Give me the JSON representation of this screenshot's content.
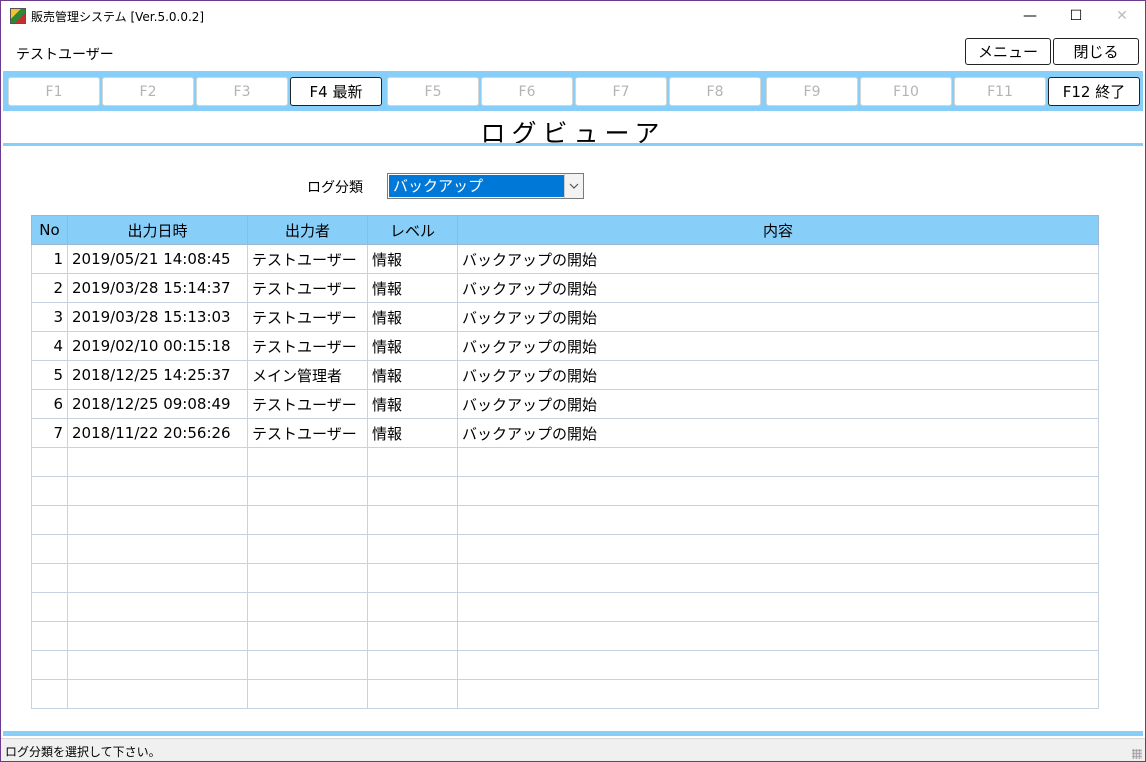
{
  "window": {
    "title": "販売管理システム [Ver.5.0.0.2]",
    "controls": {
      "minimize": "—",
      "maximize": "☐",
      "close": "✕"
    }
  },
  "header": {
    "user": "テストユーザー",
    "menu_label": "メニュー",
    "close_label": "閉じる"
  },
  "function_keys": [
    {
      "label": "F1",
      "active": false
    },
    {
      "label": "F2",
      "active": false
    },
    {
      "label": "F3",
      "active": false
    },
    {
      "label": "F4 最新",
      "active": true
    },
    {
      "label": "F5",
      "active": false
    },
    {
      "label": "F6",
      "active": false
    },
    {
      "label": "F7",
      "active": false
    },
    {
      "label": "F8",
      "active": false
    },
    {
      "label": "F9",
      "active": false
    },
    {
      "label": "F10",
      "active": false
    },
    {
      "label": "F11",
      "active": false
    },
    {
      "label": "F12 終了",
      "active": true
    }
  ],
  "screen_title": "ログビューア",
  "filter": {
    "label": "ログ分類",
    "selected": "バックアップ"
  },
  "table": {
    "columns": [
      "No",
      "出力日時",
      "出力者",
      "レベル",
      "内容"
    ],
    "rows": [
      [
        "1",
        "2019/05/21 14:08:45",
        "テストユーザー",
        "情報",
        "バックアップの開始"
      ],
      [
        "2",
        "2019/03/28 15:14:37",
        "テストユーザー",
        "情報",
        "バックアップの開始"
      ],
      [
        "3",
        "2019/03/28 15:13:03",
        "テストユーザー",
        "情報",
        "バックアップの開始"
      ],
      [
        "4",
        "2019/02/10 00:15:18",
        "テストユーザー",
        "情報",
        "バックアップの開始"
      ],
      [
        "5",
        "2018/12/25 14:25:37",
        "メイン管理者",
        "情報",
        "バックアップの開始"
      ],
      [
        "6",
        "2018/12/25 09:08:49",
        "テストユーザー",
        "情報",
        "バックアップの開始"
      ],
      [
        "7",
        "2018/11/22 20:56:26",
        "テストユーザー",
        "情報",
        "バックアップの開始"
      ]
    ],
    "empty_rows": 9
  },
  "status": "ログ分類を選択して下さい。",
  "colors": {
    "accent": "#87cff8",
    "selection": "#0078d7",
    "window_border": "#6e3a8e"
  }
}
